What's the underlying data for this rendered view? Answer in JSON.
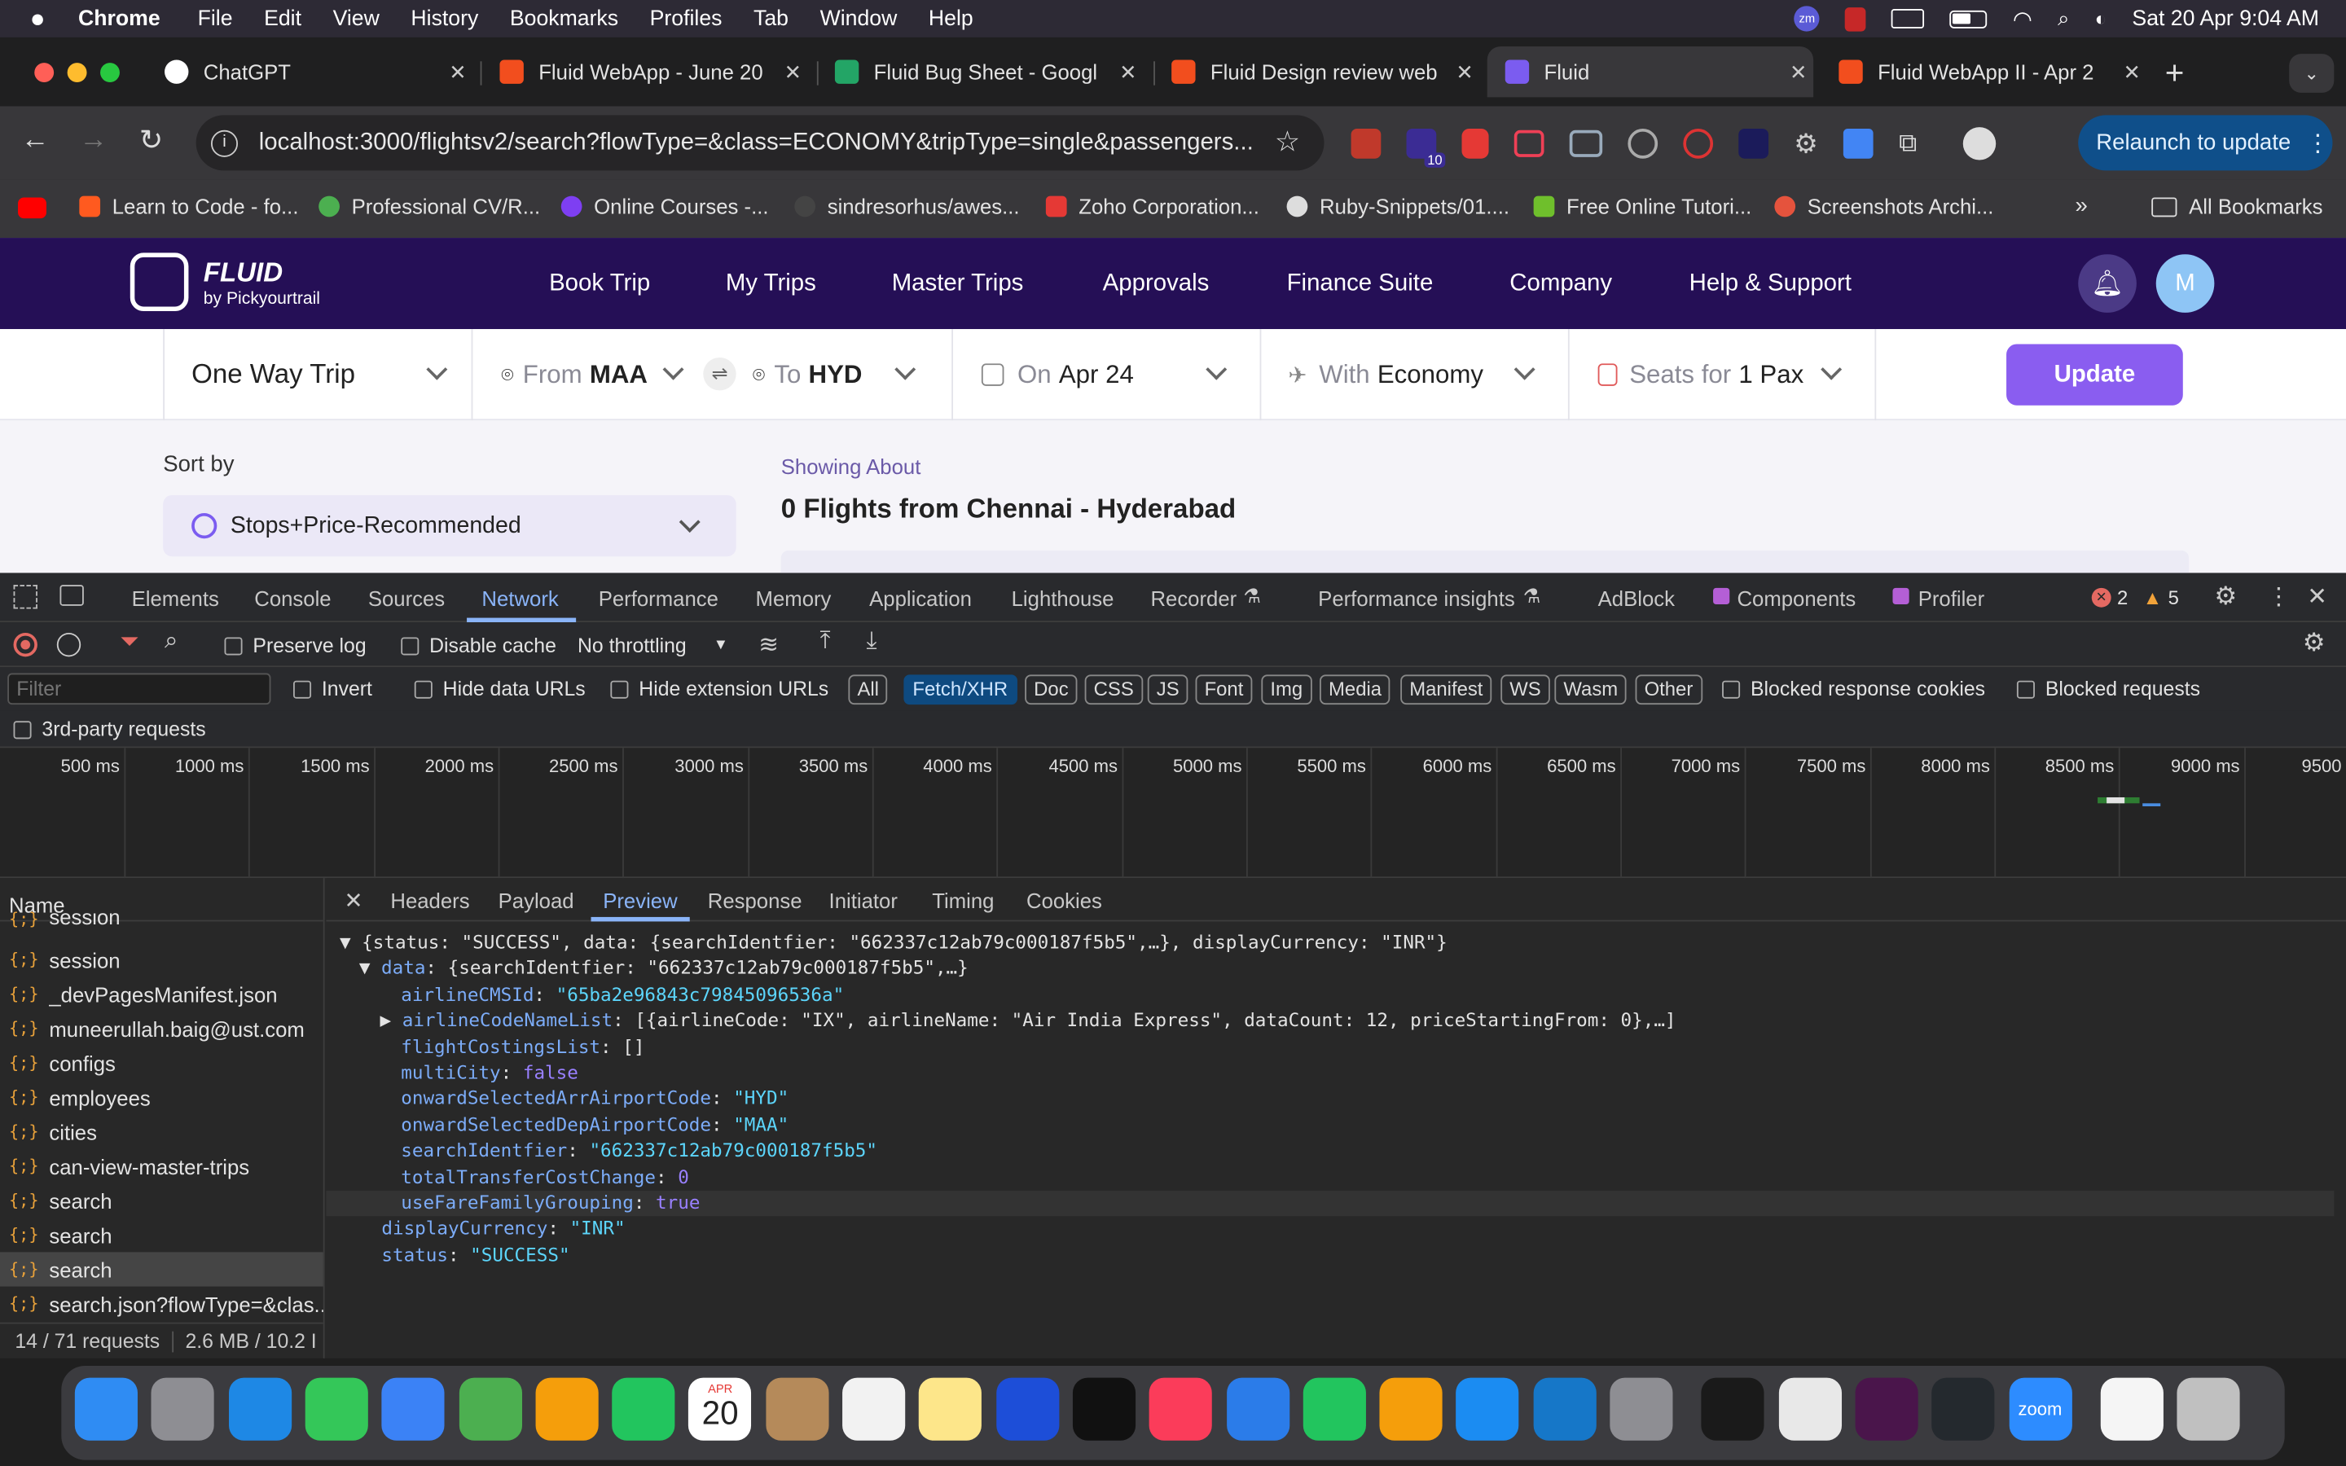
{
  "menubar": {
    "apple": "",
    "app": "Chrome",
    "items": [
      "File",
      "Edit",
      "View",
      "History",
      "Bookmarks",
      "Profiles",
      "Tab",
      "Window",
      "Help"
    ],
    "datetime": "Sat 20 Apr  9:04 AM"
  },
  "tabs": [
    {
      "title": "ChatGPT",
      "color": "#ffffff"
    },
    {
      "title": "Fluid WebApp - June 20",
      "color": "#f24e1e"
    },
    {
      "title": "Fluid Bug Sheet - Googl",
      "color": "#23a566"
    },
    {
      "title": "Fluid Design review web",
      "color": "#f24e1e"
    },
    {
      "title": "Fluid",
      "color": "#7b5cf0"
    },
    {
      "title": "Fluid WebApp II - Apr 2",
      "color": "#f24e1e"
    }
  ],
  "toolbar": {
    "url": "localhost:3000/flightsv2/search?flowType=&class=ECONOMY&tripType=single&passengers...",
    "relaunch": "Relaunch to update",
    "ext_badge": "10"
  },
  "bookmarks": [
    {
      "label": "Learn to Code - fo...",
      "color": "#ff5a1f"
    },
    {
      "label": "Professional CV/R...",
      "color": "#4caf50"
    },
    {
      "label": "Online Courses -...",
      "color": "#7e3ff2"
    },
    {
      "label": "sindresorhus/awes...",
      "color": "#444"
    },
    {
      "label": "Zoho Corporation...",
      "color": "#e53935"
    },
    {
      "label": "Ruby-Snippets/01....",
      "color": "#222"
    },
    {
      "label": "Free Online Tutori...",
      "color": "#6fbf2c"
    },
    {
      "label": "Screenshots Archi...",
      "color": "#e5533d"
    }
  ],
  "all_bookmarks": "All Bookmarks",
  "site": {
    "logo": "FLUID",
    "logo_sub": "by Pickyourtrail",
    "nav": [
      "Book Trip",
      "My Trips",
      "Master Trips",
      "Approvals",
      "Finance Suite",
      "Company",
      "Help & Support"
    ],
    "avatar": "M",
    "search": {
      "trip": "One Way Trip",
      "from_label": "From",
      "from": "MAA",
      "to_label": "To",
      "to": "HYD",
      "date_label": "On",
      "date": "Apr 24",
      "class_label": "With",
      "class": "Economy",
      "seats_label": "Seats for",
      "seats": "1 Pax",
      "update": "Update"
    },
    "sort_label": "Sort by",
    "sort_value": "Stops+Price-Recommended",
    "showing": "Showing About",
    "result": "0 Flights from Chennai - Hyderabad"
  },
  "devtools": {
    "tabs": [
      "Elements",
      "Console",
      "Sources",
      "Network",
      "Performance",
      "Memory",
      "Application",
      "Lighthouse",
      "Recorder",
      "Performance insights",
      "AdBlock",
      "Components",
      "Profiler"
    ],
    "errors": "2",
    "warnings": "5",
    "preserve_log": "Preserve log",
    "disable_cache": "Disable cache",
    "throttling": "No throttling",
    "filter_placeholder": "Filter",
    "invert": "Invert",
    "hide_data": "Hide data URLs",
    "hide_ext": "Hide extension URLs",
    "types": [
      "All",
      "Fetch/XHR",
      "Doc",
      "CSS",
      "JS",
      "Font",
      "Img",
      "Media",
      "Manifest",
      "WS",
      "Wasm",
      "Other"
    ],
    "blocked_cookies": "Blocked response cookies",
    "blocked_requests": "Blocked requests",
    "third_party": "3rd-party requests",
    "ticks": [
      "500 ms",
      "1000 ms",
      "1500 ms",
      "2000 ms",
      "2500 ms",
      "3000 ms",
      "3500 ms",
      "4000 ms",
      "4500 ms",
      "5000 ms",
      "5500 ms",
      "6000 ms",
      "6500 ms",
      "7000 ms",
      "7500 ms",
      "8000 ms",
      "8500 ms",
      "9000 ms",
      "9500"
    ],
    "name_header": "Name",
    "requests": [
      "session",
      "session",
      "_devPagesManifest.json",
      "muneerullah.baig@ust.com",
      "configs",
      "employees",
      "cities",
      "can-view-master-trips",
      "search",
      "search",
      "search",
      "search.json?flowType=&clas..."
    ],
    "status_bar": "14 / 71 requests",
    "transfer": "2.6 MB / 10.2 I",
    "preview_tabs": [
      "Headers",
      "Payload",
      "Preview",
      "Response",
      "Initiator",
      "Timing",
      "Cookies"
    ],
    "json": {
      "root": "{status: \"SUCCESS\", data: {searchIdentfier: \"662337c12ab79c000187f5b5\",…}, displayCurrency: \"INR\"}",
      "data_summary": "{searchIdentfier: \"662337c12ab79c000187f5b5\",…}",
      "airlineCMSId": "\"65ba2e96843c79845096536a\"",
      "airlineCodeNameList": "[{airlineCode: \"IX\", airlineName: \"Air India Express\", dataCount: 12, priceStartingFrom: 0},…]",
      "flightCostingsList": "[]",
      "multiCity": "false",
      "onwardSelectedArrAirportCode": "\"HYD\"",
      "onwardSelectedDepAirportCode": "\"MAA\"",
      "searchIdentfier": "\"662337c12ab79c000187f5b5\"",
      "totalTransferCostChange": "0",
      "useFareFamilyGrouping": "true",
      "displayCurrency": "\"INR\"",
      "status": "\"SUCCESS\""
    }
  },
  "dock": {
    "calendar_month": "APR",
    "calendar_day": "20",
    "apps": [
      "finder-icon",
      "launchpad-icon",
      "safari-icon",
      "messages-icon",
      "mail-icon",
      "maps-icon",
      "photos-icon",
      "facetime-icon",
      "calendar-icon",
      "contacts-icon",
      "reminders-icon",
      "notes-icon",
      "freeform-icon",
      "tv-icon",
      "music-icon",
      "keynote-icon",
      "numbers-icon",
      "pages-icon",
      "app-store-icon",
      "vscode-icon",
      "settings-icon",
      "terminal-icon",
      "chrome-icon",
      "slack-icon",
      "github-icon",
      "zoom-icon",
      "document-icon",
      "trash-icon"
    ],
    "colors": [
      "#2f8cf3",
      "#8e8e93",
      "#1e88e5",
      "#34c759",
      "#3b82f6",
      "#4caf50",
      "#f59e0b",
      "#22c55e",
      "#ffffff",
      "#b58a5a",
      "#f2f2f2",
      "#fde68a",
      "#1d4ed8",
      "#111111",
      "#fb3c5a",
      "#2b7ce9",
      "#22c55e",
      "#f59e0b",
      "#1b8cf2",
      "#1677c8",
      "#8e8e93",
      "#1a1a1a",
      "#e8e8e8",
      "#4a154b",
      "#24292e",
      "#2d8cff",
      "#f5f5f5",
      "#c0c0c0"
    ],
    "zoom": "zoom"
  }
}
